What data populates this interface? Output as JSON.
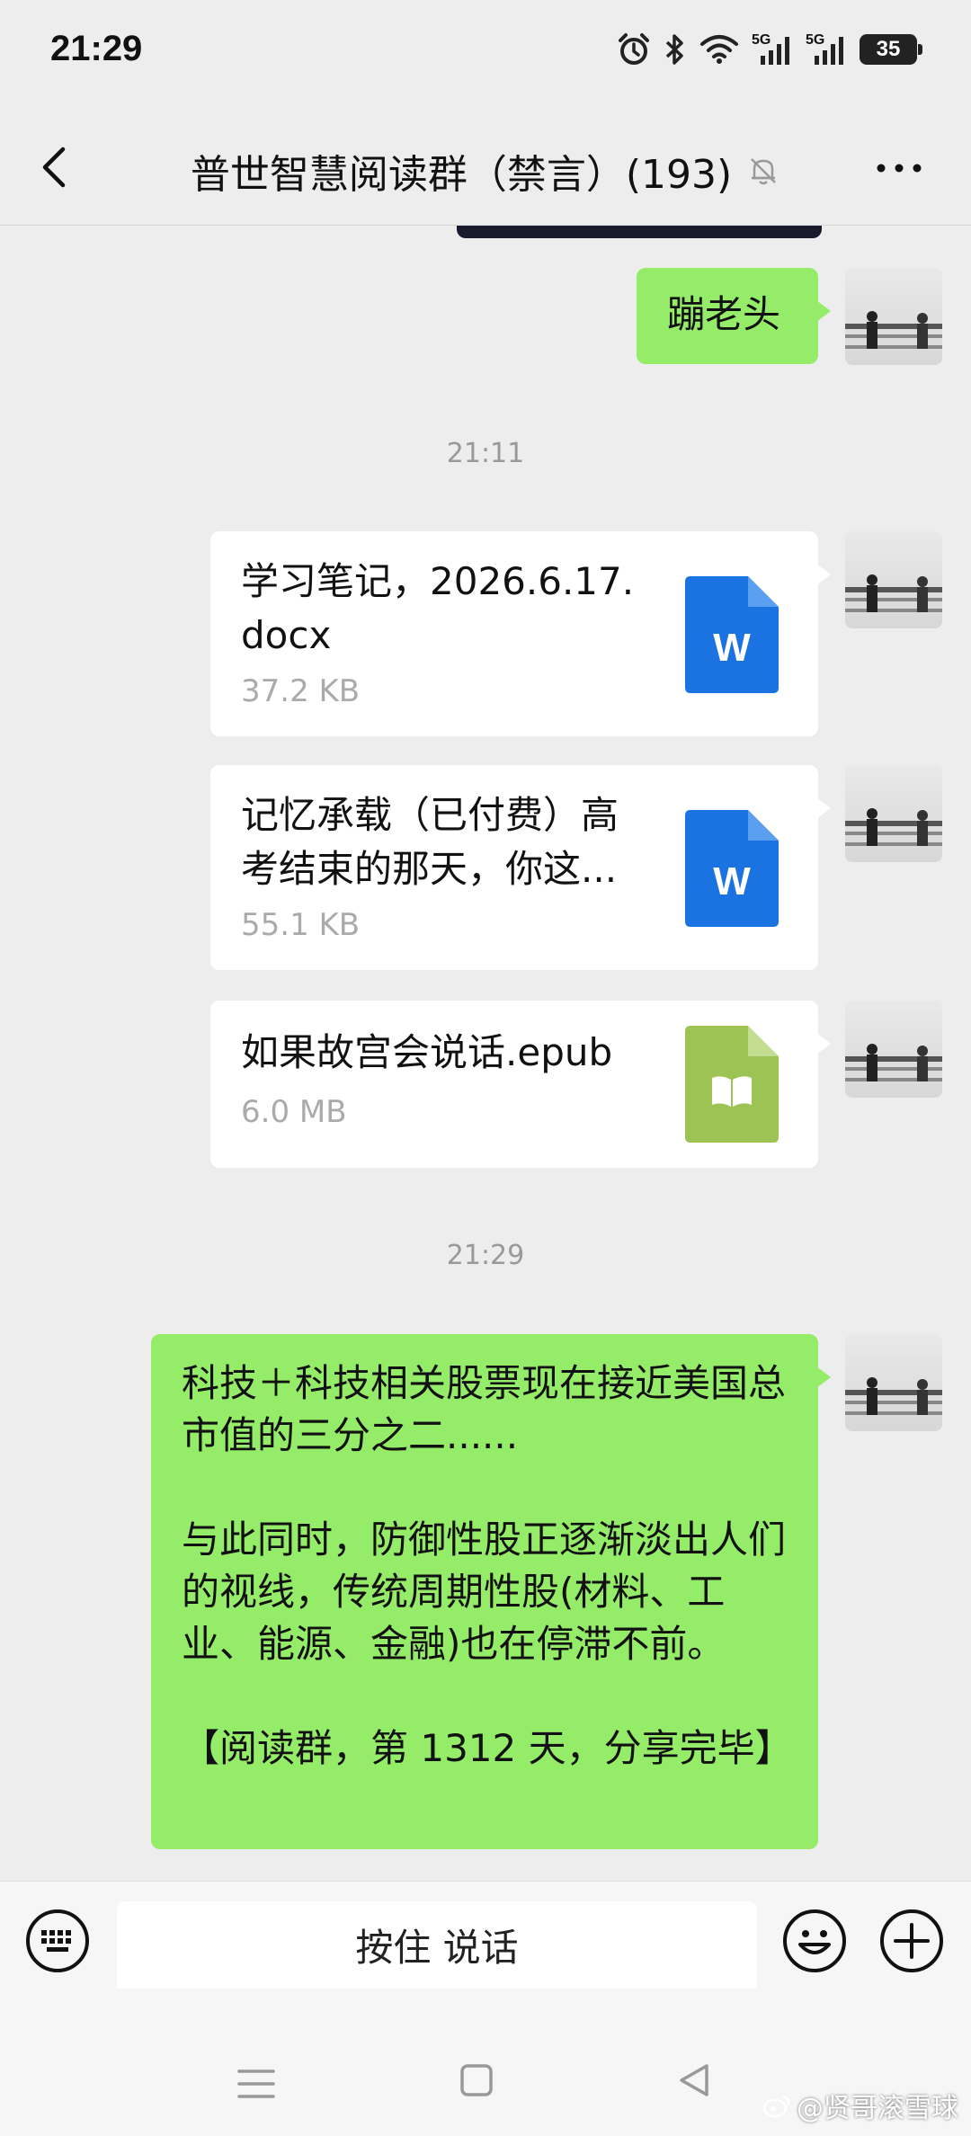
{
  "status_bar": {
    "time": "21:29",
    "net1": "5G",
    "net2": "5G",
    "battery": "35"
  },
  "header": {
    "title": "普世智慧阅读群（禁言）(193)"
  },
  "messages": {
    "m1": {
      "text": "蹦老头"
    },
    "ts1": "21:11",
    "f1": {
      "name": "学习笔记，2026.6.17.docx",
      "size": "37.2 KB",
      "icon_label": "W"
    },
    "f2": {
      "name": "记忆承载（已付费）高考结束的那天，你这...",
      "size": "55.1 KB",
      "icon_label": "W"
    },
    "f3": {
      "name": "如果故宫会说话.epub",
      "size": "6.0 MB"
    },
    "ts2": "21:29",
    "m2": {
      "text": "科技＋科技相关股票现在接近美国总市值的三分之二......\n\n与此同时，防御性股正逐渐淡出人们的视线，传统周期性股(材料、工业、能源、金融)也在停滞不前。\n\n【阅读群，第 1312 天，分享完毕】"
    }
  },
  "input_bar": {
    "voice_label": "按住 说话"
  },
  "watermark": "@贤哥滚雪球",
  "colors": {
    "bubble_green": "#95ec69",
    "word_icon": "#1b73e2",
    "epub_icon": "#9cc354",
    "background": "#ededed"
  }
}
